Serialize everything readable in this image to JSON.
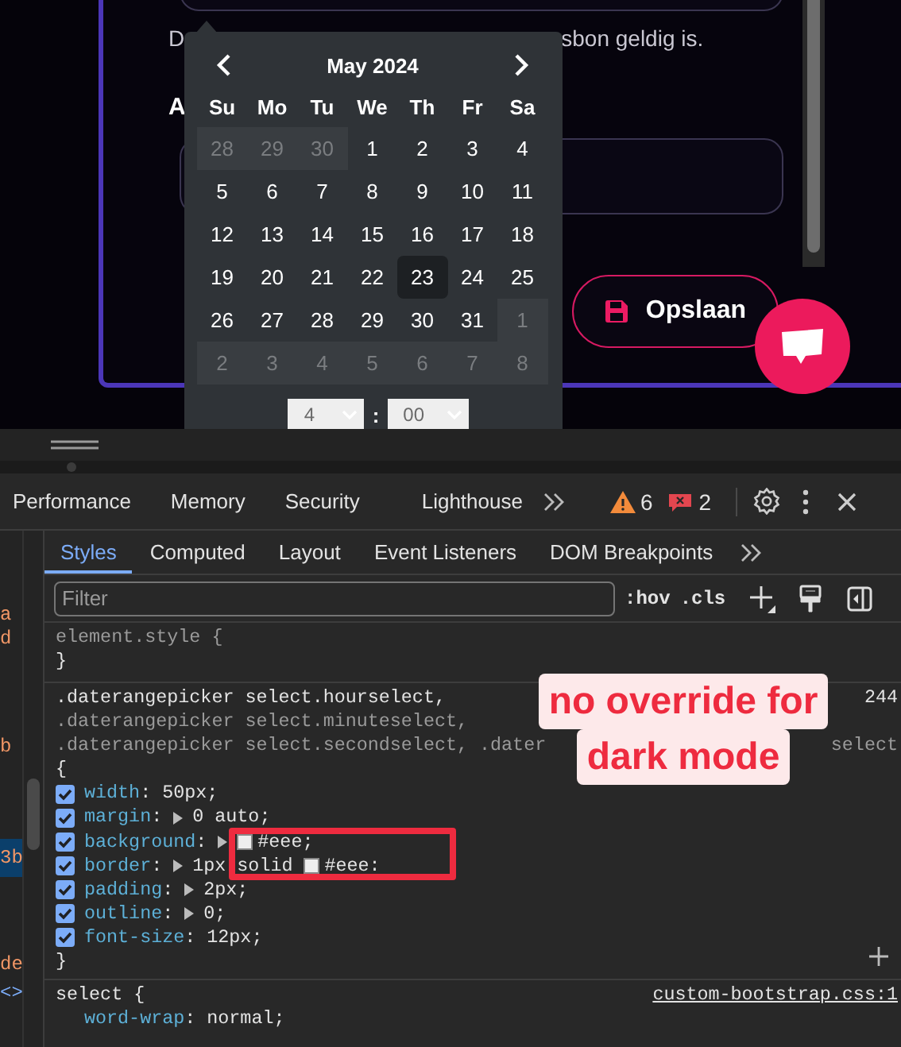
{
  "form": {
    "hint_start": "D",
    "hint_end": "sbon geldig is.",
    "label": "A",
    "save_button": "Opslaan"
  },
  "datepicker": {
    "month": "May 2024",
    "weekdays": [
      "Su",
      "Mo",
      "Tu",
      "We",
      "Th",
      "Fr",
      "Sa"
    ],
    "days": [
      {
        "day": "28",
        "off_month": true,
        "selected": false
      },
      {
        "day": "29",
        "off_month": true,
        "selected": false
      },
      {
        "day": "30",
        "off_month": true,
        "selected": false
      },
      {
        "day": "1",
        "off_month": false,
        "selected": false
      },
      {
        "day": "2",
        "off_month": false,
        "selected": false
      },
      {
        "day": "3",
        "off_month": false,
        "selected": false
      },
      {
        "day": "4",
        "off_month": false,
        "selected": false
      },
      {
        "day": "5",
        "off_month": false,
        "selected": false
      },
      {
        "day": "6",
        "off_month": false,
        "selected": false
      },
      {
        "day": "7",
        "off_month": false,
        "selected": false
      },
      {
        "day": "8",
        "off_month": false,
        "selected": false
      },
      {
        "day": "9",
        "off_month": false,
        "selected": false
      },
      {
        "day": "10",
        "off_month": false,
        "selected": false
      },
      {
        "day": "11",
        "off_month": false,
        "selected": false
      },
      {
        "day": "12",
        "off_month": false,
        "selected": false
      },
      {
        "day": "13",
        "off_month": false,
        "selected": false
      },
      {
        "day": "14",
        "off_month": false,
        "selected": false
      },
      {
        "day": "15",
        "off_month": false,
        "selected": false
      },
      {
        "day": "16",
        "off_month": false,
        "selected": false
      },
      {
        "day": "17",
        "off_month": false,
        "selected": false
      },
      {
        "day": "18",
        "off_month": false,
        "selected": false
      },
      {
        "day": "19",
        "off_month": false,
        "selected": false
      },
      {
        "day": "20",
        "off_month": false,
        "selected": false
      },
      {
        "day": "21",
        "off_month": false,
        "selected": false
      },
      {
        "day": "22",
        "off_month": false,
        "selected": false
      },
      {
        "day": "23",
        "off_month": false,
        "selected": true
      },
      {
        "day": "24",
        "off_month": false,
        "selected": false
      },
      {
        "day": "25",
        "off_month": false,
        "selected": false
      },
      {
        "day": "26",
        "off_month": false,
        "selected": false
      },
      {
        "day": "27",
        "off_month": false,
        "selected": false
      },
      {
        "day": "28",
        "off_month": false,
        "selected": false
      },
      {
        "day": "29",
        "off_month": false,
        "selected": false
      },
      {
        "day": "30",
        "off_month": false,
        "selected": false
      },
      {
        "day": "31",
        "off_month": false,
        "selected": false
      },
      {
        "day": "1",
        "off_month": true,
        "selected": false
      },
      {
        "day": "2",
        "off_month": true,
        "selected": false
      },
      {
        "day": "3",
        "off_month": true,
        "selected": false
      },
      {
        "day": "4",
        "off_month": true,
        "selected": false
      },
      {
        "day": "5",
        "off_month": true,
        "selected": false
      },
      {
        "day": "6",
        "off_month": true,
        "selected": false
      },
      {
        "day": "7",
        "off_month": true,
        "selected": false
      },
      {
        "day": "8",
        "off_month": true,
        "selected": false
      }
    ],
    "time": {
      "hour": "4",
      "separator": ":",
      "minute": "00"
    }
  },
  "devtools": {
    "main_tabs": [
      "Performance",
      "Memory",
      "Security",
      "Lighthouse"
    ],
    "warnings": "6",
    "errors": "2",
    "sub_tabs": [
      {
        "label": "Styles",
        "selected": true
      },
      {
        "label": "Computed",
        "selected": false
      },
      {
        "label": "Layout",
        "selected": false
      },
      {
        "label": "Event Listeners",
        "selected": false
      },
      {
        "label": "DOM Breakpoints",
        "selected": false
      }
    ],
    "filter": {
      "placeholder": "Filter"
    },
    "hov": ":hov",
    "cls": ".cls",
    "elements_fragments": [
      {
        "text": "a",
        "kind": "attr"
      },
      {
        "text": "d",
        "kind": "attr"
      },
      {
        "text": "b",
        "kind": "attr"
      },
      {
        "text": "3b",
        "kind": "selected"
      },
      {
        "text": "de",
        "kind": "attr"
      },
      {
        "text": "<>",
        "kind": "tag"
      }
    ],
    "element_style": {
      "open": "element.style {",
      "close": "}"
    },
    "rule": {
      "selectors": [
        {
          "text": ".daterangepicker select.hourselect,",
          "matched": true
        },
        {
          "text": ".daterangepicker select.minuteselect,",
          "matched": false
        },
        {
          "text": ".daterangepicker select.secondselect, .dater",
          "matched": false
        }
      ],
      "source": "244",
      "selector_tail": "select",
      "open": "{",
      "close": "}",
      "declarations": [
        {
          "checked": true,
          "property": "width",
          "separator": ":",
          "value": "50px;"
        },
        {
          "checked": true,
          "property": "margin",
          "separator": ":",
          "expandable": true,
          "value": "0 auto;"
        },
        {
          "checked": true,
          "property": "background",
          "separator": ":",
          "expandable": true,
          "color": "#eeeeee",
          "value_after": "#eee;"
        },
        {
          "checked": true,
          "property": "border",
          "separator": ":",
          "expandable": true,
          "value": "1px solid",
          "color": "#eeeeee",
          "value_after": "#eee:"
        },
        {
          "checked": true,
          "property": "padding",
          "separator": ":",
          "expandable": true,
          "value": "2px;"
        },
        {
          "checked": true,
          "property": "outline",
          "separator": ":",
          "expandable": true,
          "value": "0;"
        },
        {
          "checked": true,
          "property": "font-size",
          "separator": ":",
          "value": "12px;"
        }
      ]
    },
    "rule2": {
      "selector": "select {",
      "source": "custom-bootstrap.css:1",
      "declarations": [
        {
          "property": "word-wrap",
          "separator": ":",
          "value": "normal;"
        }
      ]
    }
  },
  "annotation": {
    "lines": [
      "no override for",
      "dark mode"
    ]
  }
}
